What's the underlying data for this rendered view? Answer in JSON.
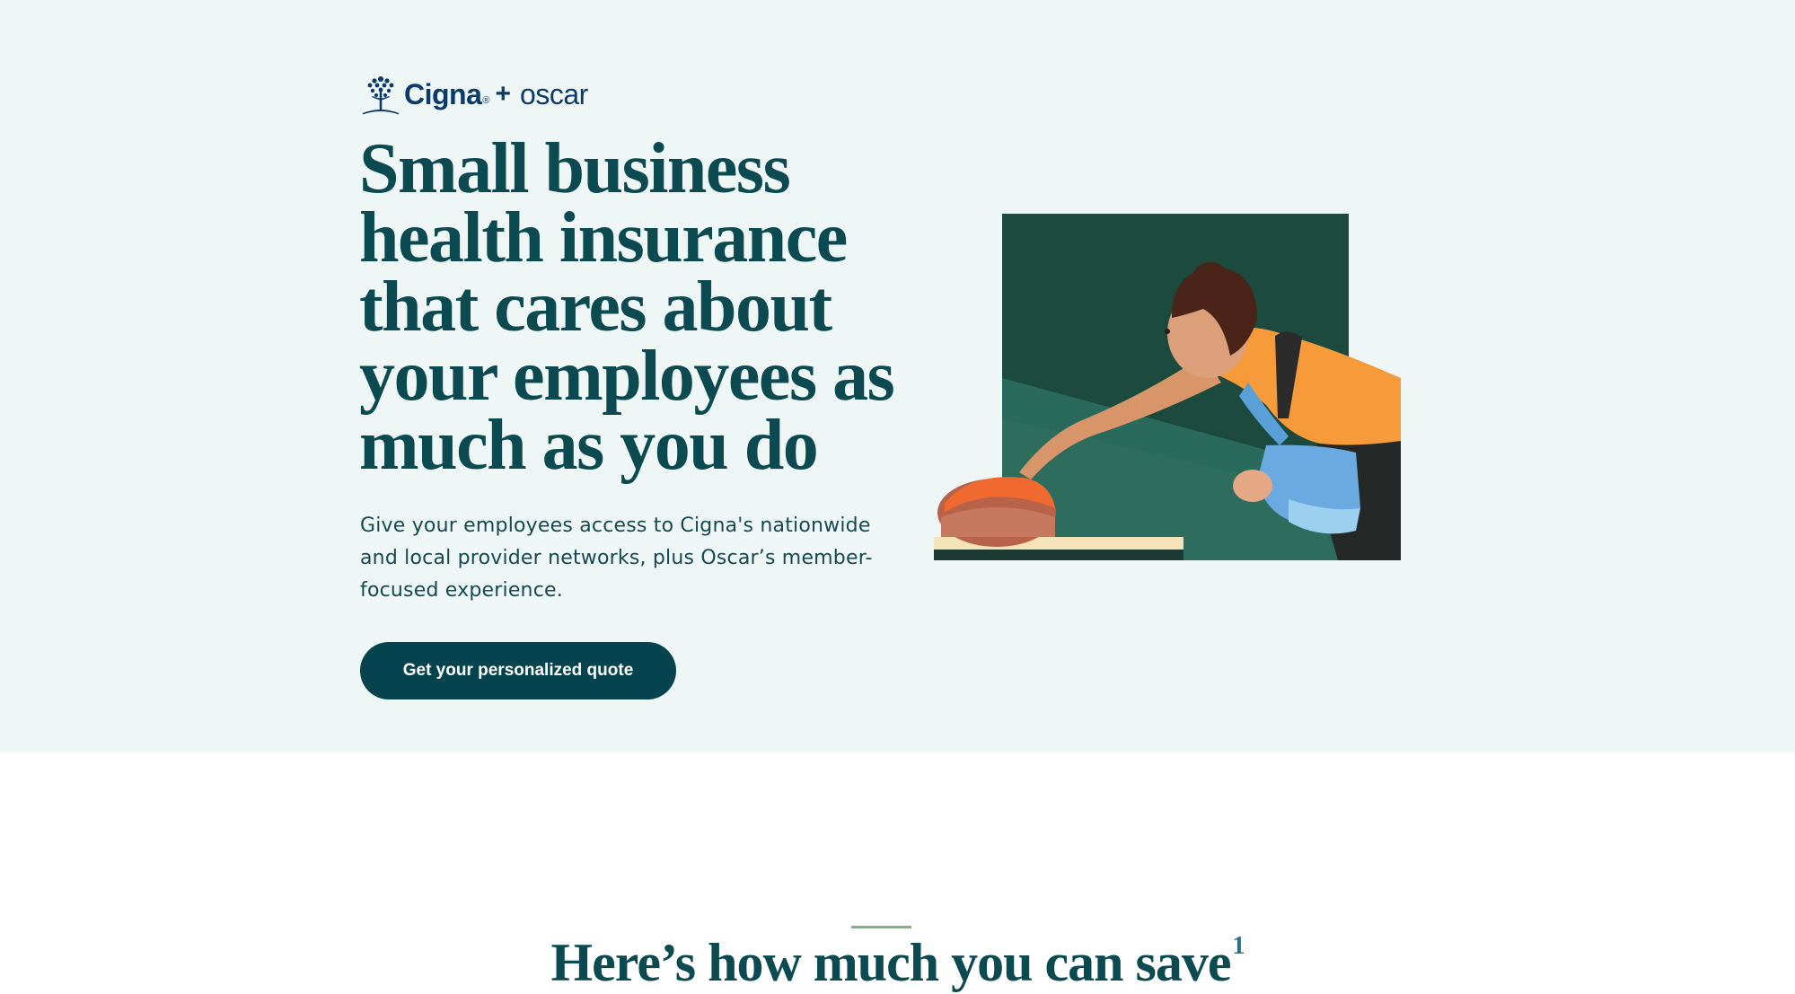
{
  "brand": {
    "primary": "Cigna",
    "registered": "®",
    "plus": "+",
    "partner": "oscar",
    "logo_icon": "tree-icon"
  },
  "hero": {
    "headline": "Small business health insurance that cares about your employees as much as you do",
    "subtext": "Give your employees access to Cigna's nationwide and local provider networks, plus Oscar’s member-focused experience.",
    "cta_label": "Get your personalized quote"
  },
  "savings": {
    "title": "Here’s how much you can save",
    "footnote": "1"
  },
  "colors": {
    "hero_bg": "#eff6f6",
    "headline": "#0a4a50",
    "cta_bg": "#05444f",
    "logo": "#0a3b6b",
    "accent_rule": "#7fb383"
  }
}
